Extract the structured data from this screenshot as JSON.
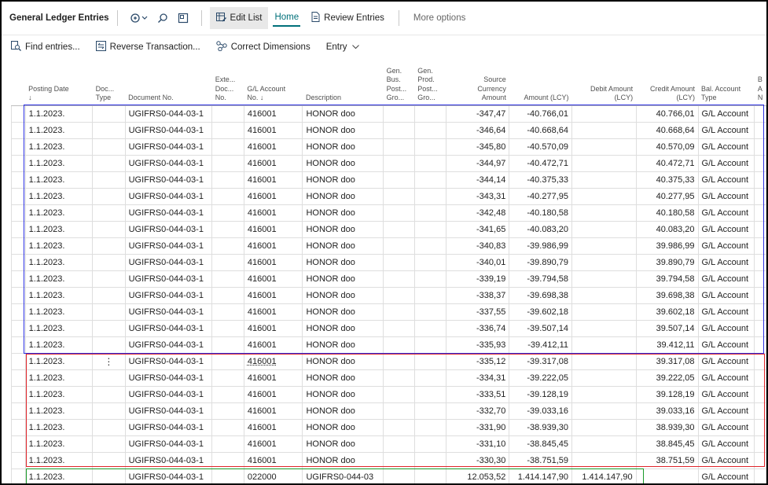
{
  "header": {
    "title": "General Ledger Entries",
    "edit_list": "Edit List",
    "home": "Home",
    "review_entries": "Review Entries",
    "more_options": "More options"
  },
  "actions": {
    "find": "Find entries...",
    "reverse": "Reverse Transaction...",
    "correct": "Correct Dimensions",
    "entry": "Entry"
  },
  "columns": [
    [
      "Posting Date",
      "↓"
    ],
    [
      "Doc...",
      "Type"
    ],
    [
      "Document No."
    ],
    [
      "Exte...",
      "Doc...",
      "No."
    ],
    [
      "G/L Account",
      "No. ↓"
    ],
    [
      "Description"
    ],
    [
      "Gen.",
      "Bus.",
      "Post...",
      "Gro..."
    ],
    [
      "Gen.",
      "Prod.",
      "Post...",
      "Gro..."
    ],
    [
      "Source",
      "Currency",
      "Amount"
    ],
    [
      "Amount (LCY)"
    ],
    [
      "Debit Amount",
      "(LCY)"
    ],
    [
      "Credit Amount",
      "(LCY)"
    ],
    [
      "Bal. Account",
      "Type"
    ],
    [
      "B",
      "A",
      "N"
    ]
  ],
  "rows": [
    {
      "date": "1.1.2023.",
      "doc": "UGIFRS0-044-03-1",
      "acc": "416001",
      "desc": "HONOR doo",
      "src": "-347,47",
      "amt": "-40.766,01",
      "debit": "",
      "credit": "40.766,01",
      "bal": "G/L Account"
    },
    {
      "date": "1.1.2023.",
      "doc": "UGIFRS0-044-03-1",
      "acc": "416001",
      "desc": "HONOR doo",
      "src": "-346,64",
      "amt": "-40.668,64",
      "debit": "",
      "credit": "40.668,64",
      "bal": "G/L Account"
    },
    {
      "date": "1.1.2023.",
      "doc": "UGIFRS0-044-03-1",
      "acc": "416001",
      "desc": "HONOR doo",
      "src": "-345,80",
      "amt": "-40.570,09",
      "debit": "",
      "credit": "40.570,09",
      "bal": "G/L Account"
    },
    {
      "date": "1.1.2023.",
      "doc": "UGIFRS0-044-03-1",
      "acc": "416001",
      "desc": "HONOR doo",
      "src": "-344,97",
      "amt": "-40.472,71",
      "debit": "",
      "credit": "40.472,71",
      "bal": "G/L Account"
    },
    {
      "date": "1.1.2023.",
      "doc": "UGIFRS0-044-03-1",
      "acc": "416001",
      "desc": "HONOR doo",
      "src": "-344,14",
      "amt": "-40.375,33",
      "debit": "",
      "credit": "40.375,33",
      "bal": "G/L Account"
    },
    {
      "date": "1.1.2023.",
      "doc": "UGIFRS0-044-03-1",
      "acc": "416001",
      "desc": "HONOR doo",
      "src": "-343,31",
      "amt": "-40.277,95",
      "debit": "",
      "credit": "40.277,95",
      "bal": "G/L Account"
    },
    {
      "date": "1.1.2023.",
      "doc": "UGIFRS0-044-03-1",
      "acc": "416001",
      "desc": "HONOR doo",
      "src": "-342,48",
      "amt": "-40.180,58",
      "debit": "",
      "credit": "40.180,58",
      "bal": "G/L Account"
    },
    {
      "date": "1.1.2023.",
      "doc": "UGIFRS0-044-03-1",
      "acc": "416001",
      "desc": "HONOR doo",
      "src": "-341,65",
      "amt": "-40.083,20",
      "debit": "",
      "credit": "40.083,20",
      "bal": "G/L Account"
    },
    {
      "date": "1.1.2023.",
      "doc": "UGIFRS0-044-03-1",
      "acc": "416001",
      "desc": "HONOR doo",
      "src": "-340,83",
      "amt": "-39.986,99",
      "debit": "",
      "credit": "39.986,99",
      "bal": "G/L Account"
    },
    {
      "date": "1.1.2023.",
      "doc": "UGIFRS0-044-03-1",
      "acc": "416001",
      "desc": "HONOR doo",
      "src": "-340,01",
      "amt": "-39.890,79",
      "debit": "",
      "credit": "39.890,79",
      "bal": "G/L Account"
    },
    {
      "date": "1.1.2023.",
      "doc": "UGIFRS0-044-03-1",
      "acc": "416001",
      "desc": "HONOR doo",
      "src": "-339,19",
      "amt": "-39.794,58",
      "debit": "",
      "credit": "39.794,58",
      "bal": "G/L Account"
    },
    {
      "date": "1.1.2023.",
      "doc": "UGIFRS0-044-03-1",
      "acc": "416001",
      "desc": "HONOR doo",
      "src": "-338,37",
      "amt": "-39.698,38",
      "debit": "",
      "credit": "39.698,38",
      "bal": "G/L Account"
    },
    {
      "date": "1.1.2023.",
      "doc": "UGIFRS0-044-03-1",
      "acc": "416001",
      "desc": "HONOR doo",
      "src": "-337,55",
      "amt": "-39.602,18",
      "debit": "",
      "credit": "39.602,18",
      "bal": "G/L Account"
    },
    {
      "date": "1.1.2023.",
      "doc": "UGIFRS0-044-03-1",
      "acc": "416001",
      "desc": "HONOR doo",
      "src": "-336,74",
      "amt": "-39.507,14",
      "debit": "",
      "credit": "39.507,14",
      "bal": "G/L Account"
    },
    {
      "date": "1.1.2023.",
      "doc": "UGIFRS0-044-03-1",
      "acc": "416001",
      "desc": "HONOR doo",
      "src": "-335,93",
      "amt": "-39.412,11",
      "debit": "",
      "credit": "39.412,11",
      "bal": "G/L Account"
    },
    {
      "date": "1.1.2023.",
      "doc": "UGIFRS0-044-03-1",
      "acc": "416001",
      "desc": "HONOR doo",
      "src": "-335,12",
      "amt": "-39.317,08",
      "debit": "",
      "credit": "39.317,08",
      "bal": "G/L Account"
    },
    {
      "date": "1.1.2023.",
      "doc": "UGIFRS0-044-03-1",
      "acc": "416001",
      "desc": "HONOR doo",
      "src": "-334,31",
      "amt": "-39.222,05",
      "debit": "",
      "credit": "39.222,05",
      "bal": "G/L Account"
    },
    {
      "date": "1.1.2023.",
      "doc": "UGIFRS0-044-03-1",
      "acc": "416001",
      "desc": "HONOR doo",
      "src": "-333,51",
      "amt": "-39.128,19",
      "debit": "",
      "credit": "39.128,19",
      "bal": "G/L Account"
    },
    {
      "date": "1.1.2023.",
      "doc": "UGIFRS0-044-03-1",
      "acc": "416001",
      "desc": "HONOR doo",
      "src": "-332,70",
      "amt": "-39.033,16",
      "debit": "",
      "credit": "39.033,16",
      "bal": "G/L Account"
    },
    {
      "date": "1.1.2023.",
      "doc": "UGIFRS0-044-03-1",
      "acc": "416001",
      "desc": "HONOR doo",
      "src": "-331,90",
      "amt": "-38.939,30",
      "debit": "",
      "credit": "38.939,30",
      "bal": "G/L Account"
    },
    {
      "date": "1.1.2023.",
      "doc": "UGIFRS0-044-03-1",
      "acc": "416001",
      "desc": "HONOR doo",
      "src": "-331,10",
      "amt": "-38.845,45",
      "debit": "",
      "credit": "38.845,45",
      "bal": "G/L Account"
    },
    {
      "date": "1.1.2023.",
      "doc": "UGIFRS0-044-03-1",
      "acc": "416001",
      "desc": "HONOR doo",
      "src": "-330,30",
      "amt": "-38.751,59",
      "debit": "",
      "credit": "38.751,59",
      "bal": "G/L Account"
    },
    {
      "date": "1.1.2023.",
      "doc": "UGIFRS0-044-03-1",
      "acc": "022000",
      "desc": "UGIFRS0-044-03",
      "src": "12.053,52",
      "amt": "1.414.147,90",
      "debit": "1.414.147,90",
      "credit": "",
      "bal": "G/L Account"
    }
  ],
  "selected_row_index": 15,
  "highlight_colors": {
    "blue": "#2a2ee0",
    "red": "#e0242a",
    "green": "#1a9b2a"
  }
}
